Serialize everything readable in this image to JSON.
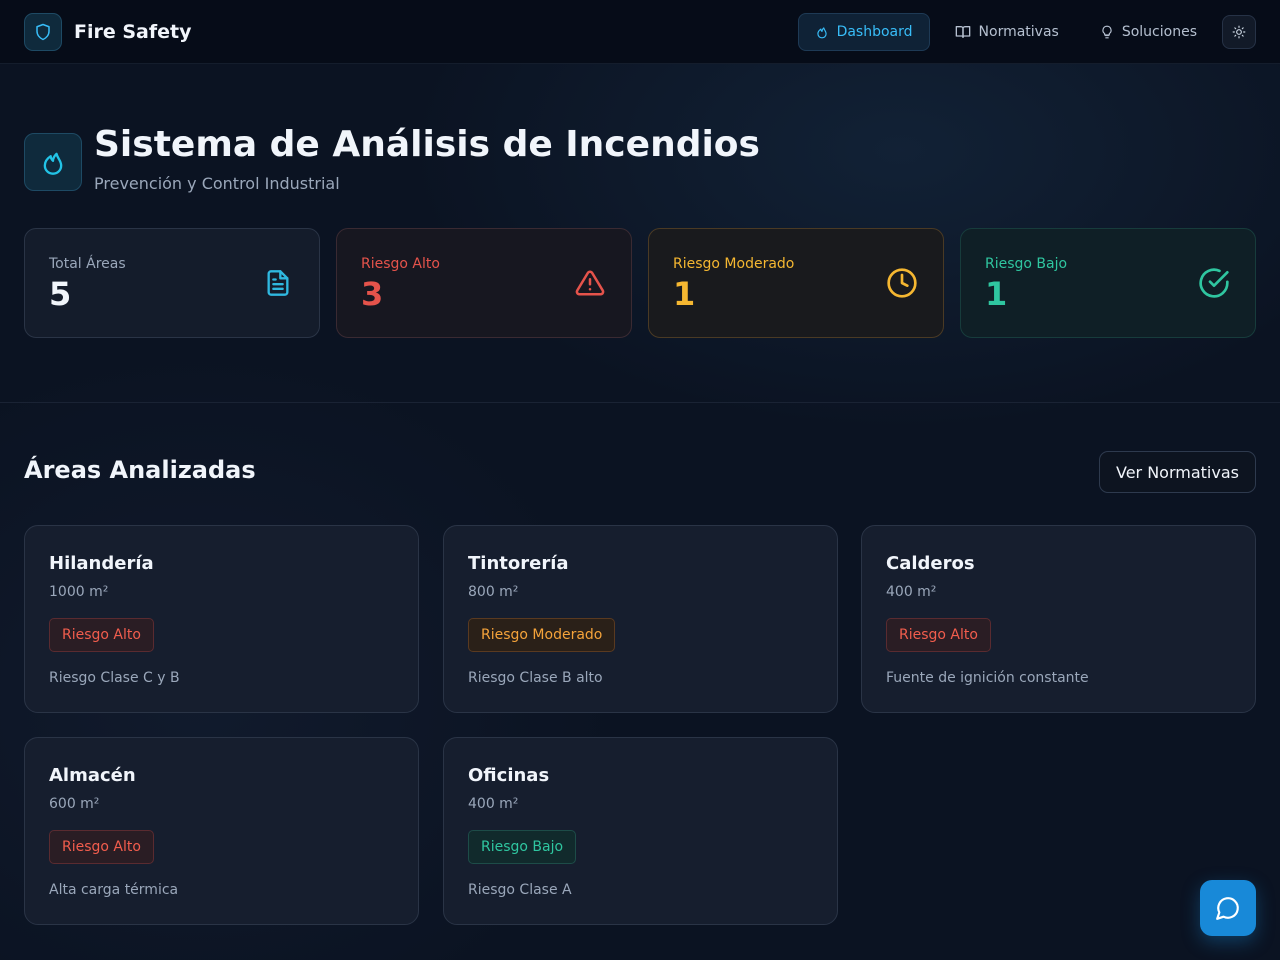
{
  "brand": {
    "name": "Fire Safety"
  },
  "nav": {
    "items": [
      {
        "label": "Dashboard",
        "icon": "flame-icon",
        "active": true
      },
      {
        "label": "Normativas",
        "icon": "book-icon",
        "active": false
      },
      {
        "label": "Soluciones",
        "icon": "lightbulb-icon",
        "active": false
      }
    ],
    "theme_icon": "sun-icon"
  },
  "hero": {
    "title": "Sistema de Análisis de Incendios",
    "subtitle": "Prevención y Control Industrial"
  },
  "stats": [
    {
      "label": "Total Áreas",
      "value": "5",
      "icon": "document-icon",
      "color": "#2fb8e0",
      "label_color": "#9aa7ba",
      "value_color": "#f1f5fb"
    },
    {
      "label": "Riesgo Alto",
      "value": "3",
      "icon": "warning-icon",
      "color": "#e5534b",
      "label_color": "#e5534b",
      "value_color": "#e5534b"
    },
    {
      "label": "Riesgo Moderado",
      "value": "1",
      "icon": "clock-icon",
      "color": "#f5b731",
      "label_color": "#f5b731",
      "value_color": "#f5b731"
    },
    {
      "label": "Riesgo Bajo",
      "value": "1",
      "icon": "check-circle-icon",
      "color": "#2fc6a0",
      "label_color": "#2fc6a0",
      "value_color": "#2fc6a0"
    }
  ],
  "section": {
    "title": "Áreas Analizadas",
    "button_label": "Ver Normativas"
  },
  "areas": [
    {
      "name": "Hilandería",
      "size": "1000 m²",
      "risk": "Riesgo Alto",
      "level": "high",
      "desc": "Riesgo Clase C y B"
    },
    {
      "name": "Tintorería",
      "size": "800 m²",
      "risk": "Riesgo Moderado",
      "level": "mod",
      "desc": "Riesgo Clase B alto"
    },
    {
      "name": "Calderos",
      "size": "400 m²",
      "risk": "Riesgo Alto",
      "level": "high",
      "desc": "Fuente de ignición constante"
    },
    {
      "name": "Almacén",
      "size": "600 m²",
      "risk": "Riesgo Alto",
      "level": "high",
      "desc": "Alta carga térmica"
    },
    {
      "name": "Oficinas",
      "size": "400 m²",
      "risk": "Riesgo Bajo",
      "level": "low",
      "desc": "Riesgo Clase A"
    }
  ],
  "chat": {
    "icon": "chat-bubble-icon"
  }
}
